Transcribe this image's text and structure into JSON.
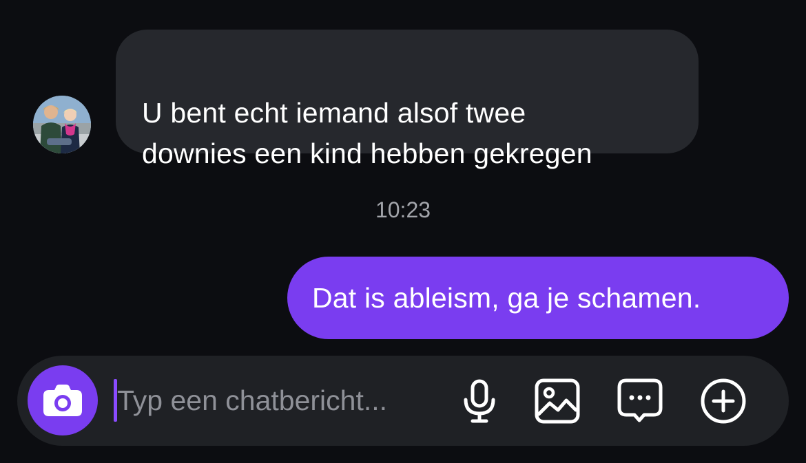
{
  "conversation": {
    "incoming_message": {
      "text": "U bent echt iemand alsof twee\ndownies een kind hebben gekregen"
    },
    "timestamp": "10:23",
    "outgoing_message": {
      "text": "Dat is ableism, ga je schamen."
    }
  },
  "composer": {
    "placeholder": "Typ een chatbericht...",
    "value": ""
  },
  "icons": {
    "avatar": "contact-photo",
    "camera": "camera-icon",
    "microphone": "microphone-icon",
    "gallery": "image-icon",
    "sticker": "chat-bubble-dots-icon",
    "more": "plus-circle-icon"
  },
  "colors": {
    "background": "#0c0d11",
    "incoming_bubble": "#26282d",
    "outgoing_bubble": "#7a3df0",
    "accent": "#7a3df0",
    "timestamp_text": "#a3a5ab",
    "composer_background": "#1f2125",
    "placeholder_text": "#8f9198"
  }
}
